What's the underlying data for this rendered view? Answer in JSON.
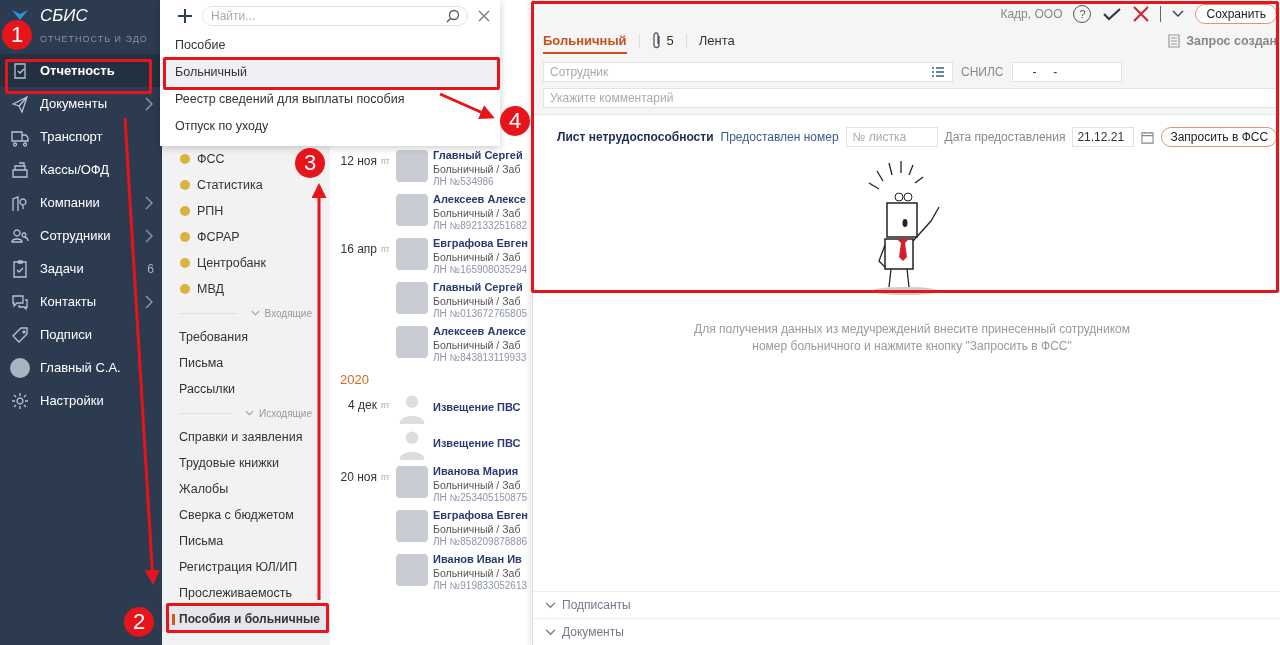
{
  "logo": {
    "title": "СБИС",
    "subtitle": "ОТЧЕТНОСТЬ И ЭДО"
  },
  "nav": [
    {
      "label": "Отчетность",
      "selected": true,
      "expandable": false
    },
    {
      "label": "Документы",
      "selected": false,
      "expandable": true
    },
    {
      "label": "Транспорт",
      "selected": false,
      "expandable": false
    },
    {
      "label": "Кассы/ОФД",
      "selected": false,
      "expandable": false
    },
    {
      "label": "Компании",
      "selected": false,
      "expandable": true
    },
    {
      "label": "Сотрудники",
      "selected": false,
      "expandable": true
    },
    {
      "label": "Задачи",
      "selected": false,
      "expandable": false,
      "count": "6"
    },
    {
      "label": "Контакты",
      "selected": false,
      "expandable": true
    },
    {
      "label": "Подписи",
      "selected": false,
      "expandable": false
    },
    {
      "label": "Главный С.А.",
      "selected": false,
      "expandable": false
    },
    {
      "label": "Настройки",
      "selected": false,
      "expandable": false
    }
  ],
  "sections": [
    {
      "kind": "agency",
      "label": "ФСС",
      "selected": false
    },
    {
      "kind": "agency",
      "label": "Статистика",
      "selected": false
    },
    {
      "kind": "agency",
      "label": "РПН",
      "selected": false
    },
    {
      "kind": "agency",
      "label": "ФСРАР",
      "selected": false
    },
    {
      "kind": "agency",
      "label": "Центробанк",
      "selected": false
    },
    {
      "kind": "agency",
      "label": "МВД",
      "selected": false
    },
    {
      "kind": "group",
      "label": "Входящие"
    },
    {
      "kind": "item",
      "label": "Требования",
      "selected": false
    },
    {
      "kind": "item",
      "label": "Письма",
      "selected": false
    },
    {
      "kind": "item",
      "label": "Рассылки",
      "selected": false
    },
    {
      "kind": "group",
      "label": "Исходящие"
    },
    {
      "kind": "item",
      "label": "Справки и заявления",
      "selected": false
    },
    {
      "kind": "item",
      "label": "Трудовые книжки",
      "selected": false
    },
    {
      "kind": "item",
      "label": "Жалобы",
      "selected": false
    },
    {
      "kind": "item",
      "label": "Сверка с бюджетом",
      "selected": false
    },
    {
      "kind": "item",
      "label": "Письма",
      "selected": false
    },
    {
      "kind": "item",
      "label": "Регистрация ЮЛ/ИП",
      "selected": false
    },
    {
      "kind": "item",
      "label": "Прослеживаемость",
      "selected": false
    },
    {
      "kind": "item",
      "label": "Пособия и больничные",
      "selected": true
    }
  ],
  "documents": [
    {
      "kind": "person",
      "date": "12 ноя",
      "weekday": "пт",
      "name": "Главный Сергей",
      "type": "Больничный / Заб",
      "number": "ЛН №534986"
    },
    {
      "kind": "person",
      "name": "Алексеев Алексе",
      "type": "Больничный / Заб",
      "number": "ЛН №892133251682"
    },
    {
      "kind": "person",
      "date": "16 апр",
      "weekday": "пт",
      "name": "Евграфова Евген",
      "type": "Больничный / Заб",
      "number": "ЛН №165908035294"
    },
    {
      "kind": "person",
      "name": "Главный Сергей",
      "type": "Больничный / Заб",
      "number": "ЛН №013672765805"
    },
    {
      "kind": "person",
      "name": "Алексеев Алексе",
      "type": "Больничный / Заб",
      "number": "ЛН №843813119933"
    },
    {
      "kind": "year",
      "label": "2020"
    },
    {
      "kind": "notice",
      "date": "4 дек",
      "weekday": "пт",
      "name": "Извещение ПВС"
    },
    {
      "kind": "notice",
      "name": "Извещение ПВС"
    },
    {
      "kind": "person",
      "date": "20 ноя",
      "weekday": "пт",
      "name": "Иванова Мария",
      "type": "Больничный / Заб",
      "number": "ЛН №253405150875"
    },
    {
      "kind": "person",
      "name": "Евграфова Евген",
      "type": "Больничный / Заб",
      "number": "ЛН №858209878886"
    },
    {
      "kind": "person",
      "name": "Иванов Иван Ив",
      "type": "Больничный / Заб",
      "number": "ЛН №919833052613"
    }
  ],
  "create_menu": {
    "search_placeholder": "Найти...",
    "items": [
      {
        "label": "Пособие",
        "selected": false
      },
      {
        "label": "Больничный",
        "selected": true
      },
      {
        "label": "Реестр сведений для выплаты пособия",
        "selected": false
      },
      {
        "label": "Отпуск по уходу",
        "selected": false
      }
    ]
  },
  "card": {
    "organization": "Кадр, ООО",
    "help": "?",
    "save_button": "Сохранить",
    "tabs": [
      {
        "kind": "text",
        "label": "Больничный",
        "selected": true
      },
      {
        "kind": "attachments",
        "label": "5",
        "selected": false
      },
      {
        "kind": "text",
        "label": "Лента",
        "selected": false
      }
    ],
    "status": "Запрос создан",
    "employee_placeholder": "Сотрудник",
    "snils_label": "СНИЛС",
    "snils_value": "-     -",
    "comment_placeholder": "Укажите комментарий",
    "sick_leave": {
      "title": "Лист нетрудоспособности",
      "number_link": "Предоставлен номер",
      "number_placeholder": "№ листка",
      "date_label": "Дата предоставления",
      "date_value": "21.12.21",
      "request_button": "Запросить в ФСС"
    },
    "hint": "Для получения данных из медучреждений внесите принесенный сотрудником номер больничного и нажмите кнопку \"Запросить в ФСС\"",
    "sections": [
      {
        "label": "Подписанты",
        "expanded": false
      },
      {
        "label": "Документы",
        "expanded": false
      }
    ]
  },
  "annotations": {
    "markers": [
      "1",
      "2",
      "3",
      "4"
    ]
  }
}
